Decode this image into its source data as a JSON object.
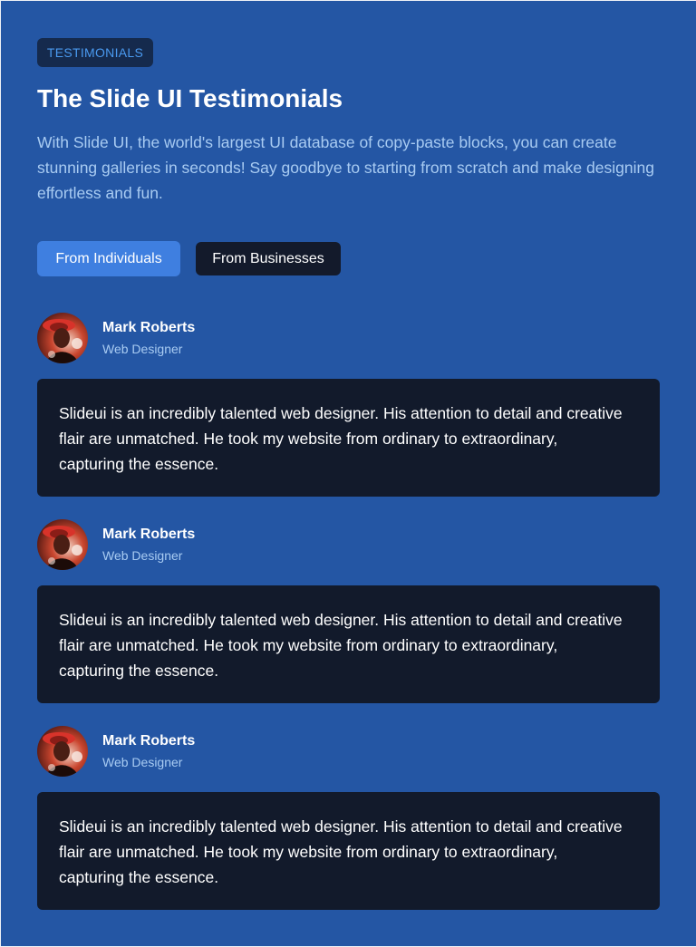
{
  "header": {
    "eyebrow": "TESTIMONIALS",
    "title": "The Slide UI Testimonials",
    "subtitle": "With Slide UI, the world's largest UI database of copy-paste blocks, you can create stunning galleries in seconds! Say goodbye to starting from scratch and make designing effortless and fun."
  },
  "tabs": [
    {
      "label": "From Individuals",
      "active": true
    },
    {
      "label": "From Businesses",
      "active": false
    }
  ],
  "testimonials": [
    {
      "name": "Mark Roberts",
      "role": "Web Designer",
      "quote": "Slideui is an incredibly talented web designer. His attention to detail and creative flair are unmatched. He took my website from ordinary to extraordinary, capturing the essence."
    },
    {
      "name": "Mark Roberts",
      "role": "Web Designer",
      "quote": "Slideui is an incredibly talented web designer. His attention to detail and creative flair are unmatched. He took my website from ordinary to extraordinary, capturing the essence."
    },
    {
      "name": "Mark Roberts",
      "role": "Web Designer",
      "quote": "Slideui is an incredibly talented web designer. His attention to detail and creative flair are unmatched. He took my website from ordinary to extraordinary, capturing the essence."
    }
  ],
  "colors": {
    "panel_background": "#2456a4",
    "eyebrow_background": "#152a4d",
    "eyebrow_text": "#4a9af0",
    "subtitle_text": "#a8cbf2",
    "active_tab": "#3f7fe0",
    "inactive_tab": "#131a2b",
    "card_background": "#121a2b"
  }
}
